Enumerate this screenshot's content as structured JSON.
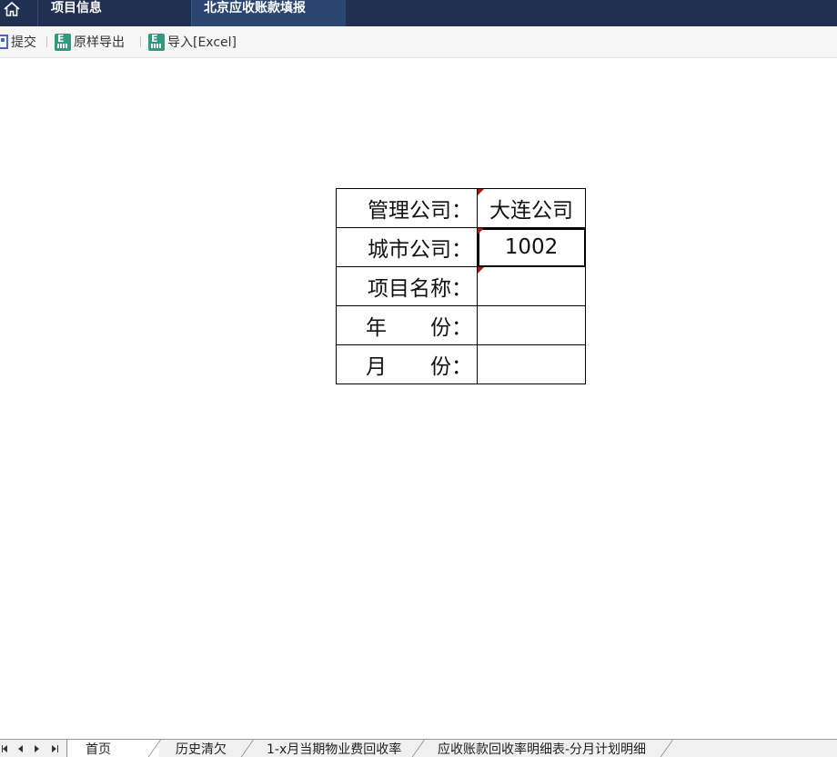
{
  "nav": {
    "tabs": [
      {
        "label": "项目信息"
      },
      {
        "label": "北京应收账款填报"
      }
    ]
  },
  "toolbar": {
    "submit_label": "提交",
    "export_label": "原样导出",
    "import_label": "导入[Excel]"
  },
  "form": {
    "rows": [
      {
        "label": "管理公司：",
        "value": "大连公司"
      },
      {
        "label": "城市公司：",
        "value": "1002"
      },
      {
        "label": "项目名称：",
        "value": ""
      },
      {
        "label_left": "年",
        "label_right": "份：",
        "value": ""
      },
      {
        "label_left": "月",
        "label_right": "份：",
        "value": ""
      }
    ]
  },
  "sheets": [
    {
      "label": "首页"
    },
    {
      "label": "历史清欠"
    },
    {
      "label": "1-x月当期物业费回收率"
    },
    {
      "label": "应收账款回收率明细表-分月计划明细"
    }
  ],
  "colors": {
    "nav_bg": "#1f3050",
    "active_nav": "#2b4670",
    "marker": "#b31616"
  }
}
